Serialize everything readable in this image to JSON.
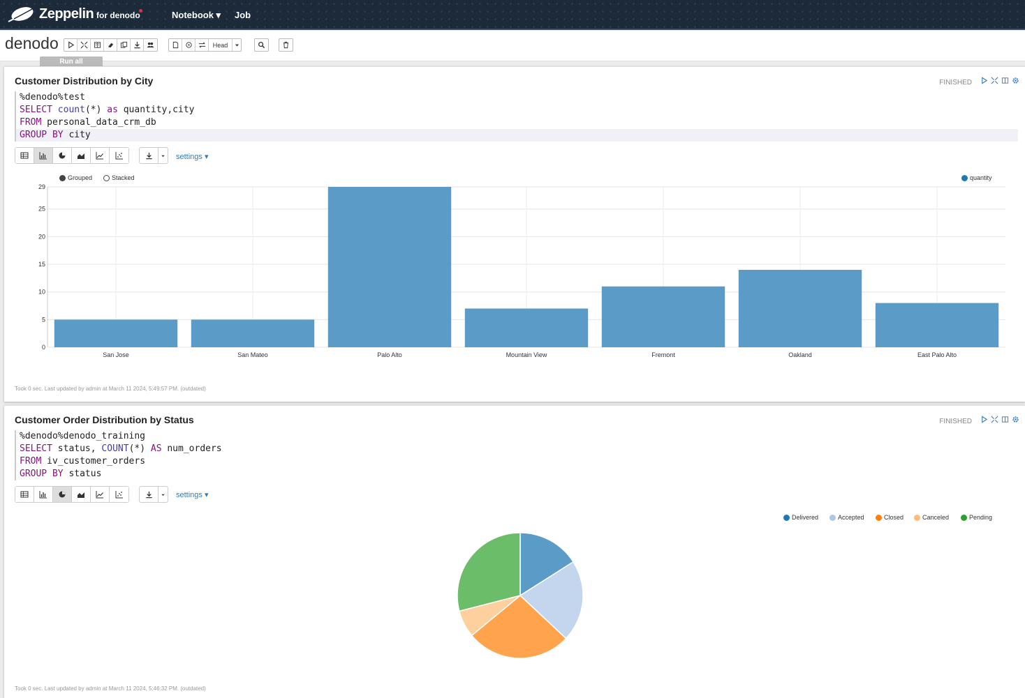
{
  "nav": {
    "brand": "Zeppelin",
    "brand_sub": "for denodo",
    "notebook": "Notebook ▾",
    "job": "Job"
  },
  "notebook": {
    "title": "denodo",
    "tooltip": "Run all paragraphs",
    "head_label": "Head"
  },
  "paragraphs": [
    {
      "title": "Customer Distribution by City",
      "status": "FINISHED",
      "code": [
        {
          "text": "%denodo%test"
        },
        {
          "kw": "SELECT",
          "fn": " count",
          "rest": "(*) ",
          "kw2": "as",
          "tail": " quantity,city"
        },
        {
          "kw": "FROM",
          "rest": " personal_data_crm_db"
        },
        {
          "kw": "GROUP BY",
          "rest": " city"
        }
      ],
      "settings": "settings ▾",
      "grouped": "Grouped",
      "stacked": "Stacked",
      "footer": "Took 0 sec. Last updated by admin at March 11 2024, 5:49:57 PM. (outdated)"
    },
    {
      "title": "Customer Order Distribution by Status",
      "status": "FINISHED",
      "code": [
        {
          "text": "%denodo%denodo_training"
        },
        {
          "kw": "SELECT",
          "rest": " status, ",
          "fn": "COUNT",
          "rest2": "(*) ",
          "kw2": "AS",
          "tail": " num_orders"
        },
        {
          "kw": "FROM",
          "rest": " iv_customer_orders"
        },
        {
          "kw": "GROUP BY",
          "rest": " status"
        }
      ],
      "settings": "settings ▾",
      "footer": "Took 0 sec. Last updated by admin at March 11 2024, 5:46:32 PM. (outdated)"
    }
  ],
  "chart_data": [
    {
      "type": "bar",
      "categories": [
        "San Jose",
        "San Mateo",
        "Palo Alto",
        "Mountain View",
        "Fremont",
        "Oakland",
        "East Palo Alto"
      ],
      "series": [
        {
          "name": "quantity",
          "values": [
            5,
            5,
            29,
            7,
            11,
            14,
            8
          ],
          "color": "#5b9bc8"
        }
      ],
      "ylim": [
        0,
        29
      ],
      "yticks": [
        0,
        5,
        10,
        15,
        20,
        25,
        29
      ],
      "grid": true,
      "legend": "top-right"
    },
    {
      "type": "pie",
      "labels": [
        "Delivered",
        "Accepted",
        "Closed",
        "Canceled",
        "Pending"
      ],
      "values": [
        16,
        21,
        27,
        7,
        29
      ],
      "colors": [
        "#5b9bc8",
        "#c3d6ee",
        "#ffa34d",
        "#fdd09e",
        "#6cbd6a"
      ],
      "legend_colors": [
        "#1f77b4",
        "#aec7e8",
        "#ff7f0e",
        "#ffbb78",
        "#2ca02c"
      ],
      "legend": "top-right"
    }
  ]
}
